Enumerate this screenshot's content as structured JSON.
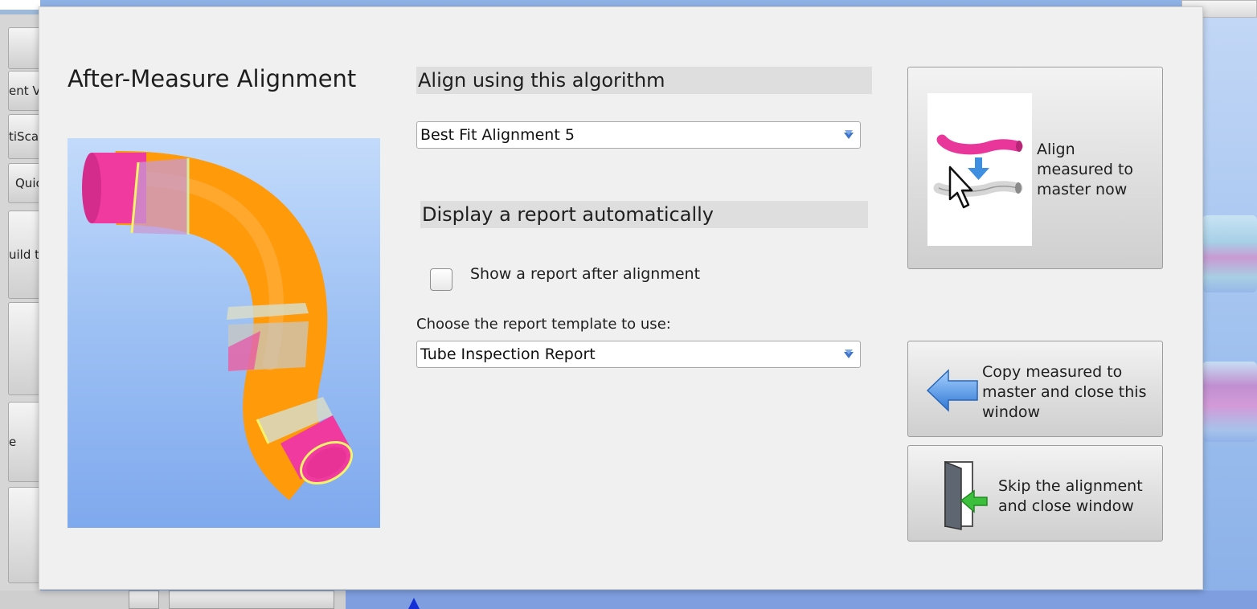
{
  "background": {
    "side_buttons": [
      "ent V",
      "tiScar",
      "Quic",
      "uild t",
      "e"
    ]
  },
  "dialog": {
    "title": "After-Measure Alignment",
    "algorithm": {
      "header": "Align using this algorithm",
      "selected": "Best Fit Alignment 5"
    },
    "report": {
      "header": "Display a report automatically",
      "checkbox_label": "Show a report after alignment",
      "checked": false,
      "template_label": "Choose the report template to use:",
      "template_selected": "Tube Inspection Report"
    },
    "buttons": {
      "align": [
        "Align",
        "measured to",
        "master now"
      ],
      "copy": [
        "Copy measured to",
        "master and close this",
        "window"
      ],
      "skip": [
        "Skip the alignment",
        "and close window"
      ]
    }
  },
  "colors": {
    "tube_orange": "#ff9a0a",
    "tube_magenta": "#f03aa0",
    "preview_bg": "#9fc2f4",
    "section_header_bg": "#dedede",
    "arrow_blue": "#3f8fe0",
    "door_arrow_green": "#3cbf3c"
  },
  "icons": [
    "dropdown-arrow-icon",
    "align-tubes-icon",
    "copy-left-arrow-icon",
    "exit-door-icon"
  ]
}
